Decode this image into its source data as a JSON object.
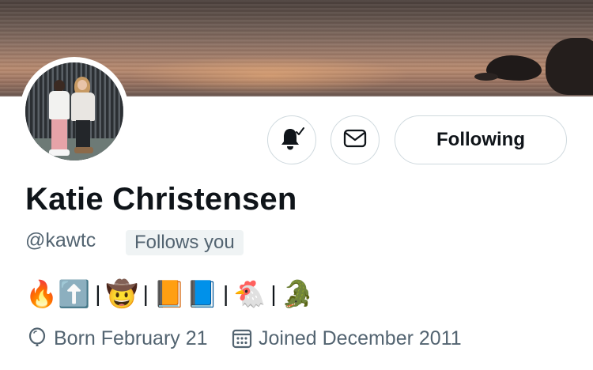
{
  "profile": {
    "name": "Katie Christensen",
    "handle": "@kawtc",
    "follows_you_label": "Follows you",
    "bio_emojis": [
      {
        "name": "fire",
        "char": "🔥"
      },
      {
        "name": "up-arrow",
        "char": "⬆️"
      },
      {
        "name": "separator",
        "char": "|"
      },
      {
        "name": "cowboy-face",
        "char": "🤠"
      },
      {
        "name": "separator",
        "char": "|"
      },
      {
        "name": "orange-book",
        "char": "📙"
      },
      {
        "name": "blue-book",
        "char": "📘"
      },
      {
        "name": "separator",
        "char": "|"
      },
      {
        "name": "chicken",
        "char": "🐔"
      },
      {
        "name": "separator",
        "char": "|"
      },
      {
        "name": "crocodile",
        "char": "🐊"
      }
    ],
    "birthday": "Born February 21",
    "joined": "Joined December 2011"
  },
  "actions": {
    "notify_icon": "bell-check-icon",
    "message_icon": "envelope-icon",
    "follow_label": "Following"
  },
  "icons": {
    "birthday": "balloon-icon",
    "joined": "calendar-icon"
  },
  "colors": {
    "text_primary": "#0f1419",
    "text_secondary": "#536471",
    "border": "#cfd9de",
    "badge_bg": "#eff3f4"
  }
}
